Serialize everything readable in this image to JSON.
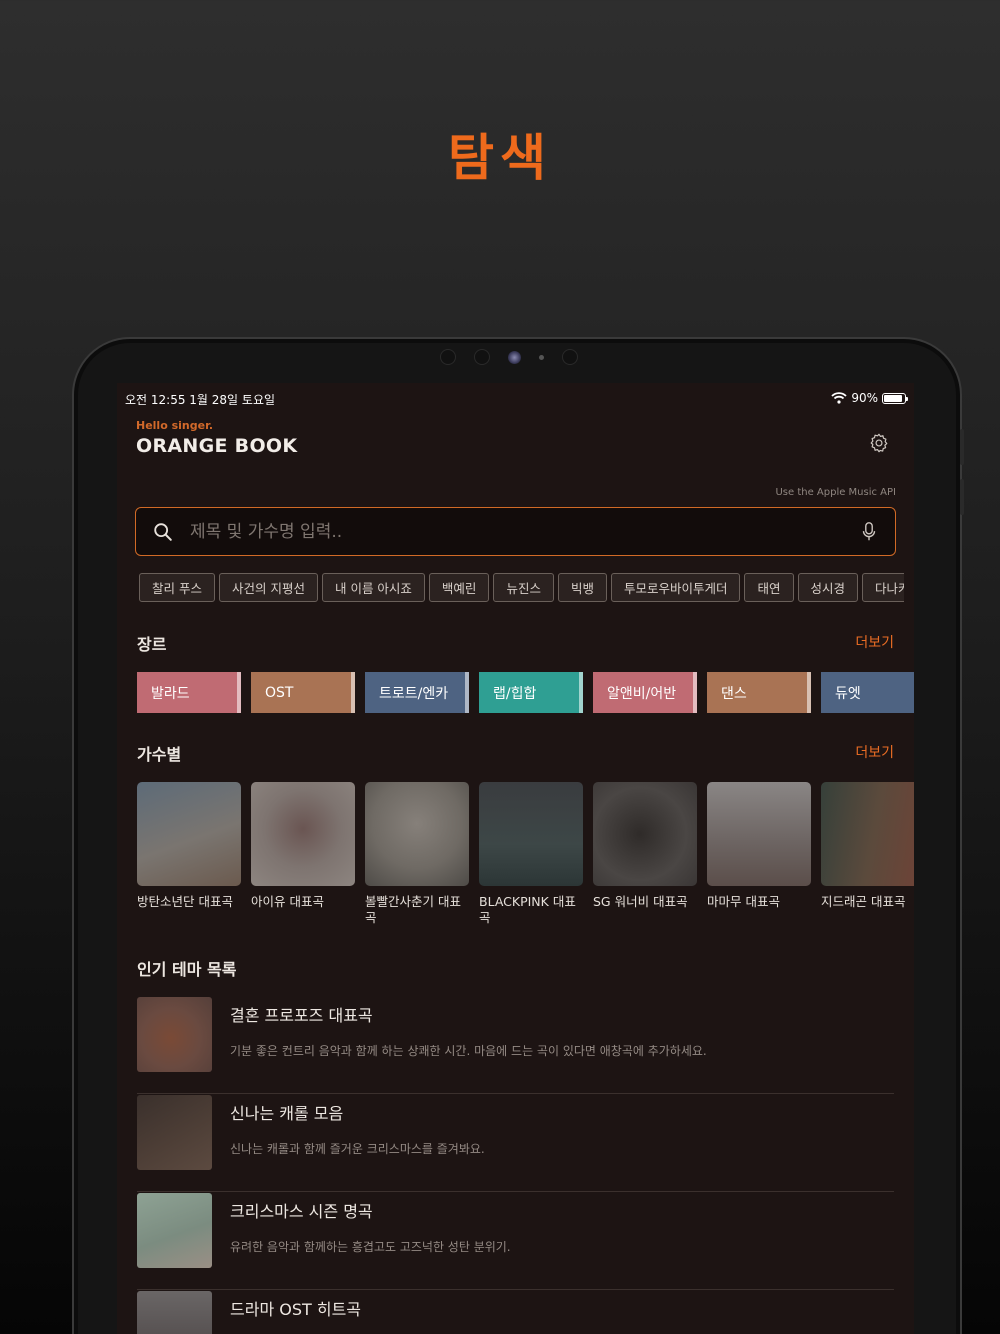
{
  "hero": {
    "title": "탐색"
  },
  "status_bar": {
    "time_date": "오전 12:55   1월 28일 토요일",
    "battery": "90%",
    "battery_level": 0.9
  },
  "header": {
    "greeting": "Hello singer.",
    "brand": "ORANGE BOOK",
    "api_note": "Use the  Apple Music API"
  },
  "search": {
    "placeholder": "제목 및 가수명 입력.."
  },
  "chips": [
    "찰리 푸스",
    "사건의 지평선",
    "내 이름 아시죠",
    "백예린",
    "뉴진스",
    "빅뱅",
    "투모로우바이투게더",
    "태연",
    "성시경",
    "다나카"
  ],
  "genre_section": {
    "title": "장르",
    "more": "더보기",
    "items": [
      {
        "label": "발라드",
        "color": "#c06b73"
      },
      {
        "label": "OST",
        "color": "#a97354"
      },
      {
        "label": "트로트/엔카",
        "color": "#4e6382"
      },
      {
        "label": "랩/힙합",
        "color": "#2f9f93"
      },
      {
        "label": "알앤비/어반",
        "color": "#c06b73"
      },
      {
        "label": "댄스",
        "color": "#a97354"
      },
      {
        "label": "듀엣",
        "color": "#4e6382"
      }
    ]
  },
  "singer_section": {
    "title": "가수별",
    "more": "더보기",
    "items": [
      {
        "name": "방탄소년단 대표곡"
      },
      {
        "name": "아이유 대표곡"
      },
      {
        "name": "볼빨간사춘기 대표곡"
      },
      {
        "name": "BLACKPINK 대표곡"
      },
      {
        "name": "SG 워너비 대표곡"
      },
      {
        "name": "마마무 대표곡"
      },
      {
        "name": "지드래곤 대표곡"
      }
    ]
  },
  "theme_section": {
    "title": "인기 테마 목록",
    "items": [
      {
        "title": "결혼 프로포즈 대표곡",
        "desc": "기분 좋은 컨트리 음악과 함께 하는 상쾌한 시간. 마음에 드는 곡이 있다면 애창곡에 추가하세요."
      },
      {
        "title": "신나는 캐롤 모음",
        "desc": "신나는 캐롤과 함께 즐거운 크리스마스를 즐겨봐요."
      },
      {
        "title": "크리스마스 시즌 명곡",
        "desc": "유려한 음악과 함께하는 흥겹고도 고즈넉한 성탄 분위기."
      },
      {
        "title": "드라마 OST 히트곡",
        "desc": ""
      }
    ]
  }
}
